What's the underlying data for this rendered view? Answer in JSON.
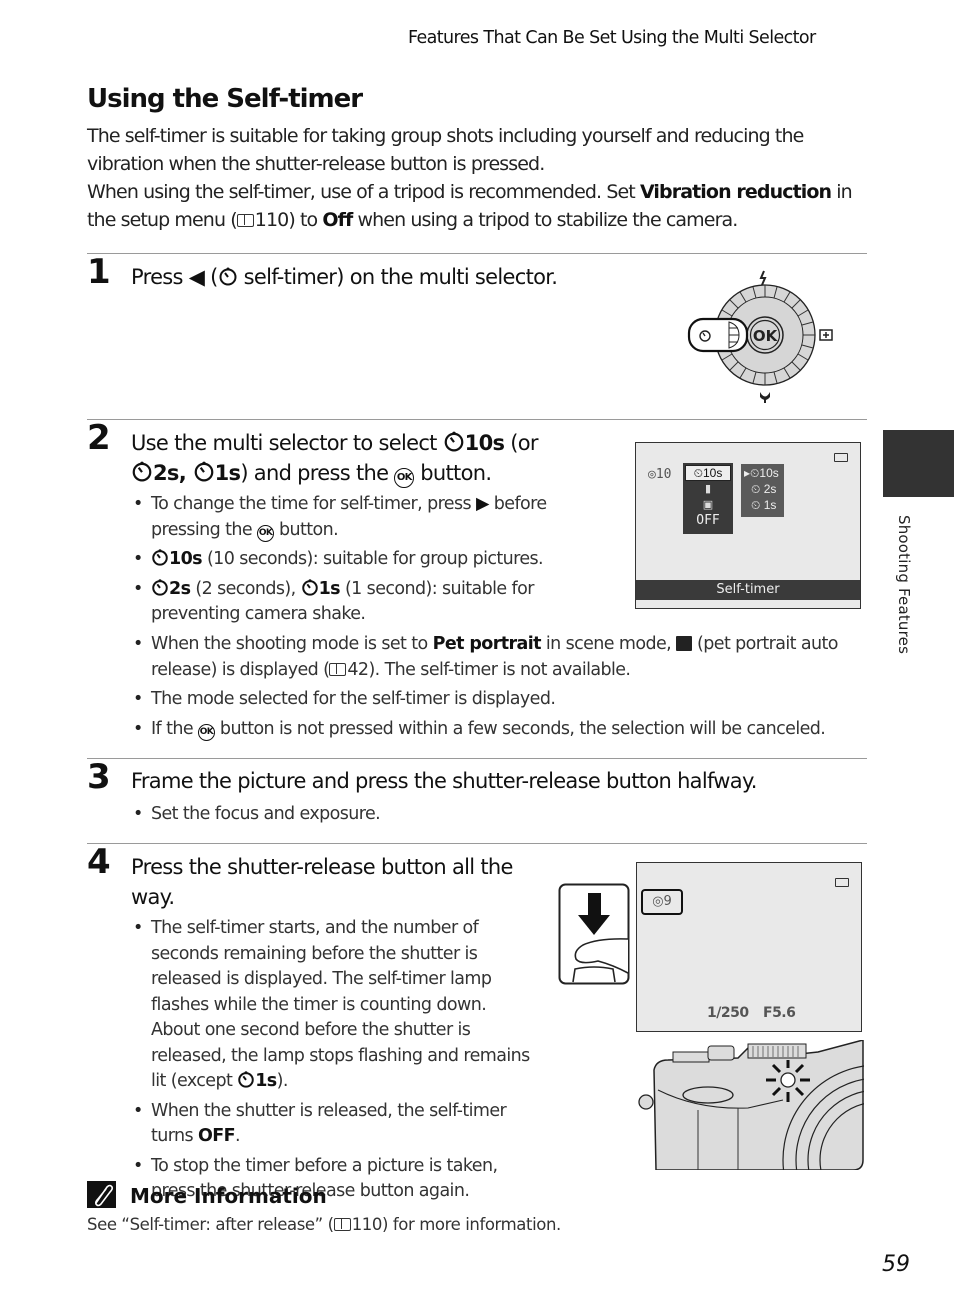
{
  "header": {
    "running_head": "Features That Can Be Set Using the Multi Selector"
  },
  "title": "Using the Self-timer",
  "intro": {
    "p1": "The self-timer is suitable for taking group shots including yourself and reducing the vibration when the shutter-release button is pressed.",
    "p2_a": "When using the self-timer, use of a tripod is recommended. Set ",
    "p2_bold1": "Vibration reduction",
    "p2_b": " in the setup menu (",
    "p2_ref": "110",
    "p2_c": ") to ",
    "p2_bold2": "Off",
    "p2_d": " when using a tripod to stabilize the camera."
  },
  "steps": [
    {
      "number": "1",
      "text_a": "Press ",
      "text_b": " (",
      "text_c": " self-timer) on the multi selector.",
      "diagram": {
        "center_label": "OK",
        "top_icon": "flash-icon",
        "right_icon": "exposure-compensation-icon",
        "bottom_icon": "macro-icon",
        "left_icon": "self-timer-icon"
      }
    },
    {
      "number": "2",
      "line1_a": "Use the multi selector to select ",
      "line1_bold": "10s",
      "line1_b": " (or",
      "line2_bold1": "2s, ",
      "line2_bold2": "1s",
      "line2_a": ") and press the ",
      "line2_b": " button.",
      "bullets": {
        "b1_a": "To change the time for self-timer, press ",
        "b1_b": " before pressing the ",
        "b1_c": " button.",
        "b2_bold": "10s",
        "b2_text": " (10 seconds): suitable for group pictures.",
        "b3_bold1": "2s",
        "b3_a": " (2 seconds), ",
        "b3_bold2": "1s",
        "b3_b": " (1 second): suitable for preventing camera shake.",
        "b4_a": "When the shooting mode is set to ",
        "b4_bold": "Pet portrait",
        "b4_b": " in scene mode, ",
        "b4_c": " (pet portrait auto release) is displayed (",
        "b4_ref": "42",
        "b4_d": "). The self-timer is not available.",
        "b5": "The mode selected for the self-timer is displayed.",
        "b6_a": "If the ",
        "b6_b": " button is not pressed within a few seconds, the selection will be canceled."
      },
      "screen": {
        "indicator": "10",
        "menu_items": [
          "10s",
          "remote",
          "pet",
          "OFF"
        ],
        "submenu_items": [
          "10s",
          "2s",
          "1s"
        ],
        "caption": "Self-timer"
      }
    },
    {
      "number": "3",
      "text": "Frame the picture and press the shutter-release button halfway.",
      "bullets": [
        "Set the focus and exposure."
      ]
    },
    {
      "number": "4",
      "text": "Press the shutter-release button all the way.",
      "bullets": {
        "b1_a": "The self-timer starts, and the number of seconds remaining before the shutter is released is displayed. The self-timer lamp flashes while the timer is counting down. About one second before the shutter is released, the lamp stops flashing and remains lit (except ",
        "b1_bold": "1s",
        "b1_b": ").",
        "b2_a": "When the shutter is released, the self-timer turns ",
        "b2_bold": "OFF",
        "b2_b": ".",
        "b3": "To stop the timer before a picture is taken, press the shutter-release button again."
      },
      "screen": {
        "countdown": "9",
        "shutter": "1/250",
        "aperture": "F5.6"
      }
    }
  ],
  "more_info": {
    "heading": "More Information",
    "text_a": "See “Self-timer: after release” (",
    "ref": "110",
    "text_b": ") for more information."
  },
  "side_tab": {
    "label": "Shooting Features"
  },
  "page_number": "59"
}
